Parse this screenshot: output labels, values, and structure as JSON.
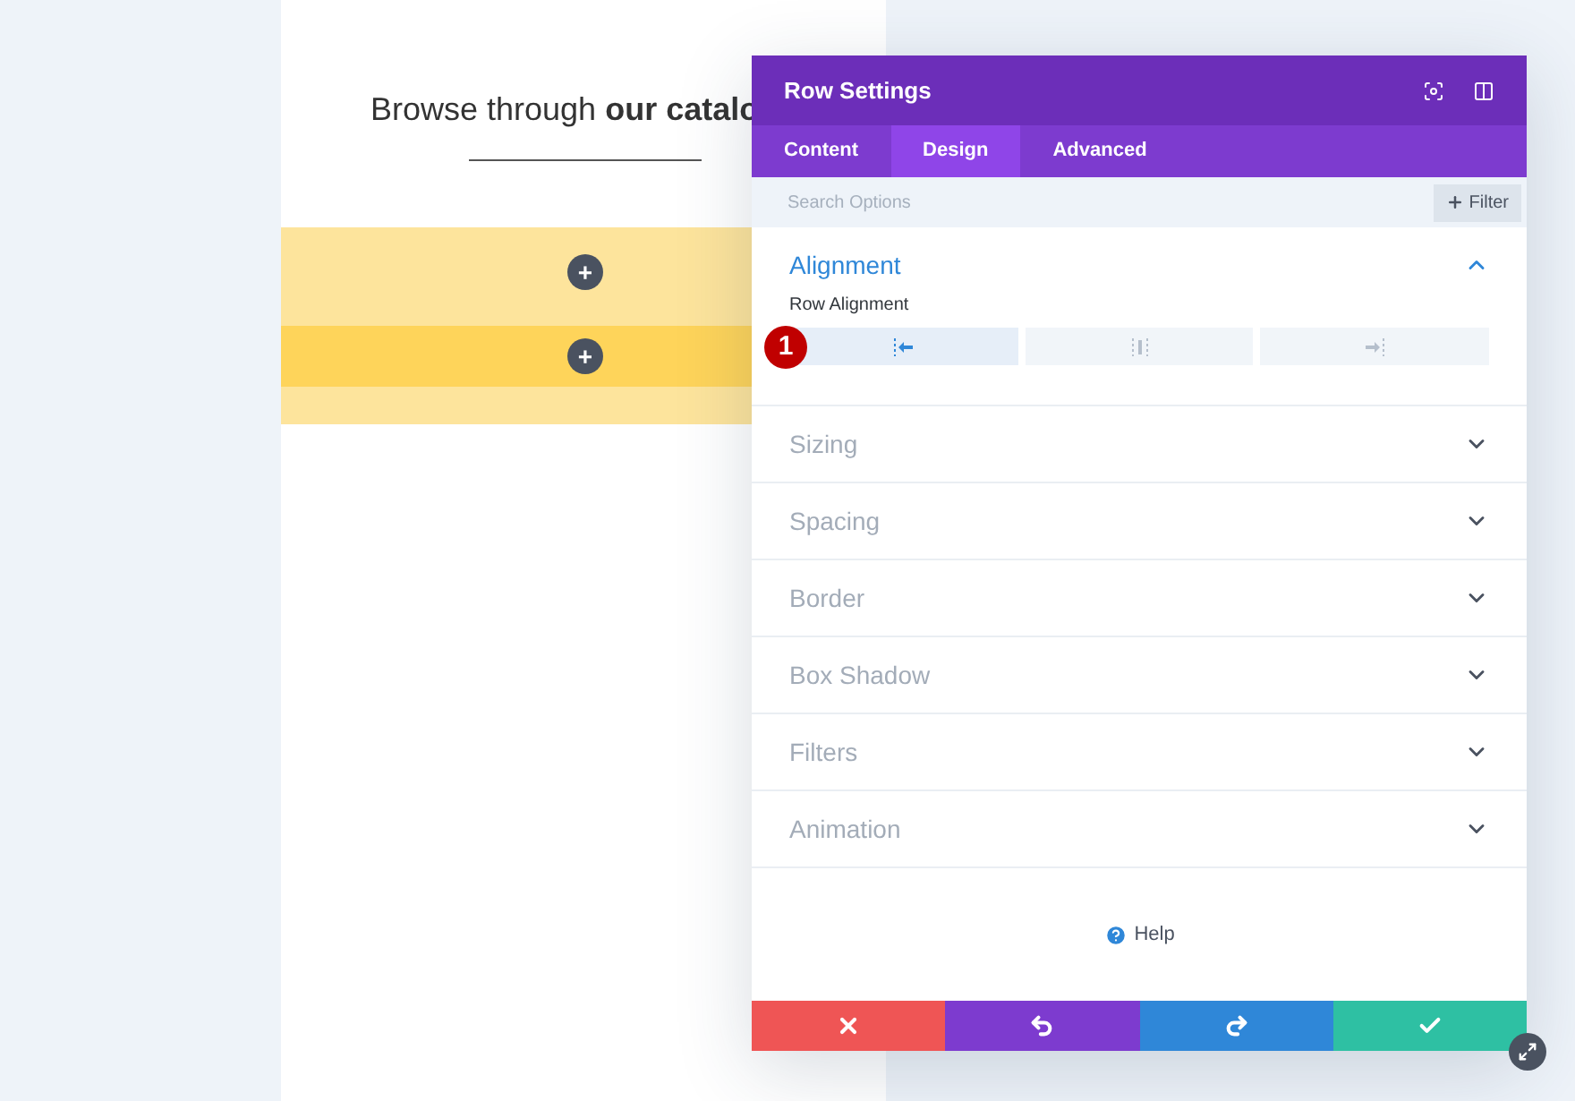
{
  "canvas": {
    "heading": "Browse through **our catalo**",
    "add_buttons": [
      "+",
      "+"
    ]
  },
  "panel": {
    "title": "Row Settings",
    "tabs": [
      {
        "label": "Content",
        "selected": false
      },
      {
        "label": "Design",
        "selected": true
      },
      {
        "label": "Advanced",
        "selected": false
      }
    ],
    "search": {
      "placeholder": "Search Options"
    },
    "filter_button": "Filter",
    "sections": [
      {
        "title": "Alignment",
        "expanded": true,
        "field_label": "Row Alignment",
        "step_badge": "1",
        "options": [
          {
            "kind": "left",
            "selected": true
          },
          {
            "kind": "center",
            "selected": false
          },
          {
            "kind": "right",
            "selected": false
          }
        ]
      },
      {
        "title": "Sizing",
        "expanded": false
      },
      {
        "title": "Spacing",
        "expanded": false
      },
      {
        "title": "Border",
        "expanded": false
      },
      {
        "title": "Box Shadow",
        "expanded": false
      },
      {
        "title": "Filters",
        "expanded": false
      },
      {
        "title": "Animation",
        "expanded": false
      }
    ],
    "help": "Help",
    "actions": [
      {
        "kind": "cancel",
        "color": "#ef5555"
      },
      {
        "kind": "undo",
        "color": "#7d3bcf"
      },
      {
        "kind": "redo",
        "color": "#2f87d8"
      },
      {
        "kind": "save",
        "color": "#2ec0a3"
      }
    ]
  }
}
